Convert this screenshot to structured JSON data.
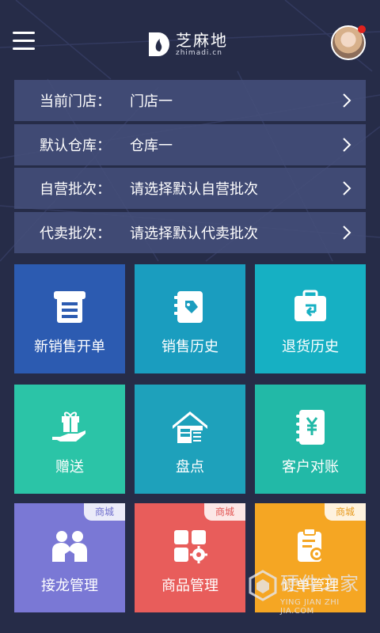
{
  "header": {
    "logo_text": "芝麻地",
    "logo_subtext": "zhimadi.cn"
  },
  "settings": [
    {
      "label": "当前门店：",
      "value": "门店一"
    },
    {
      "label": "默认仓库：",
      "value": "仓库一"
    },
    {
      "label": "自营批次：",
      "value": "请选择默认自营批次"
    },
    {
      "label": "代卖批次：",
      "value": "请选择默认代卖批次"
    }
  ],
  "tiles": [
    {
      "label": "新销售开单",
      "color": "#2c5bb1",
      "icon": "cashier-icon"
    },
    {
      "label": "销售历史",
      "color": "#1a9dbf",
      "icon": "notebook-tag-icon"
    },
    {
      "label": "退货历史",
      "color": "#16b0c3",
      "icon": "return-box-icon"
    },
    {
      "label": "赠送",
      "color": "#2bc4a7",
      "icon": "gift-hand-icon"
    },
    {
      "label": "盘点",
      "color": "#1ea1bb",
      "icon": "warehouse-icon"
    },
    {
      "label": "客户对账",
      "color": "#22b9a7",
      "icon": "ledger-yen-icon"
    },
    {
      "label": "接龙管理",
      "color": "#7a78d5",
      "icon": "people-icon",
      "tag": "商城",
      "tag_color": "#6e6ccc"
    },
    {
      "label": "商品管理",
      "color": "#e85d5b",
      "icon": "grid-gear-icon",
      "tag": "商城",
      "tag_color": "#e25452"
    },
    {
      "label": "订单管理",
      "color": "#f5a623",
      "icon": "clipboard-gear-icon",
      "tag": "商城",
      "tag_color": "#e79a1d"
    }
  ],
  "watermark": {
    "main": "硬件之家",
    "sub": "YING JIAN ZHI JIA.COM"
  },
  "colors": {
    "background": "#262c48",
    "row_background": "#444e7a",
    "notification_dot": "#e0221e"
  }
}
